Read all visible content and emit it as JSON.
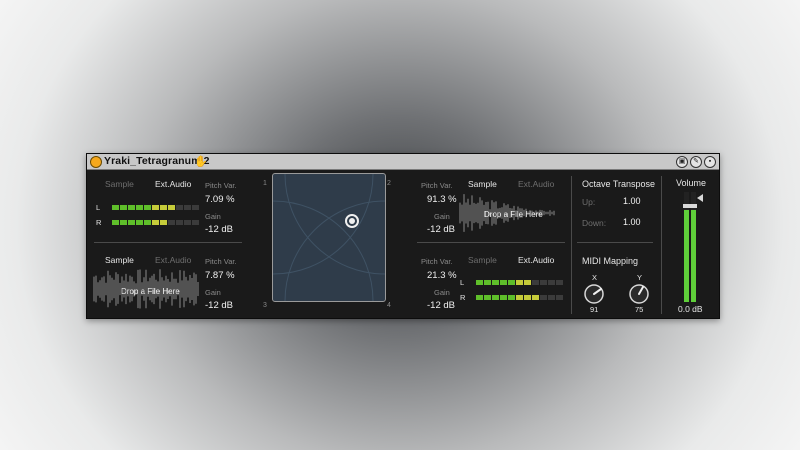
{
  "device": {
    "title": "Yraki_Tetragranum 2",
    "hand_icon": "hand-icon",
    "buttons": [
      "fold-icon",
      "edit-icon",
      "save-icon"
    ]
  },
  "colors": {
    "power": "#f5a81c",
    "meter_green": "#5fbf2a",
    "meter_yellow": "#c6cc3a",
    "pad_bg": "#2f3c4a"
  },
  "slot_top_left": {
    "tab_sample": "Sample",
    "tab_ext": "Ext.Audio",
    "active": "Ext.Audio",
    "pitch_label": "Pitch Var.",
    "pitch_value": "7.09 %",
    "gain_label": "Gain",
    "gain_value": "-12 dB",
    "meter_l": "L",
    "meter_r": "R"
  },
  "slot_bottom_left": {
    "tab_sample": "Sample",
    "tab_ext": "Ext.Audio",
    "active": "Sample",
    "drop_text": "Drop a File Here",
    "pitch_label": "Pitch Var.",
    "pitch_value": "7.87 %",
    "gain_label": "Gain",
    "gain_value": "-12 dB"
  },
  "slot_top_right": {
    "tab_sample": "Sample",
    "tab_ext": "Ext.Audio",
    "active": "Sample",
    "drop_text": "Drop a File Here",
    "pitch_label": "Pitch Var.",
    "pitch_value": "91.3 %",
    "gain_label": "Gain",
    "gain_value": "-12 dB"
  },
  "slot_bottom_right": {
    "tab_sample": "Sample",
    "tab_ext": "Ext.Audio",
    "active": "Ext.Audio",
    "pitch_label": "Pitch Var.",
    "pitch_value": "21.3 %",
    "gain_label": "Gain",
    "gain_value": "-12 dB",
    "meter_l": "L",
    "meter_r": "R"
  },
  "xy_pad": {
    "corner_1": "1",
    "corner_2": "2",
    "corner_3": "3",
    "corner_4": "4"
  },
  "octave": {
    "title": "Octave Transpose",
    "up_label": "Up:",
    "up_value": "1.00",
    "down_label": "Down:",
    "down_value": "1.00"
  },
  "midi": {
    "title": "MIDI Mapping",
    "x_label": "X",
    "x_value": "91",
    "y_label": "Y",
    "y_value": "75"
  },
  "volume": {
    "title": "Volume",
    "value": "0.0 dB",
    "level": 0.84
  }
}
